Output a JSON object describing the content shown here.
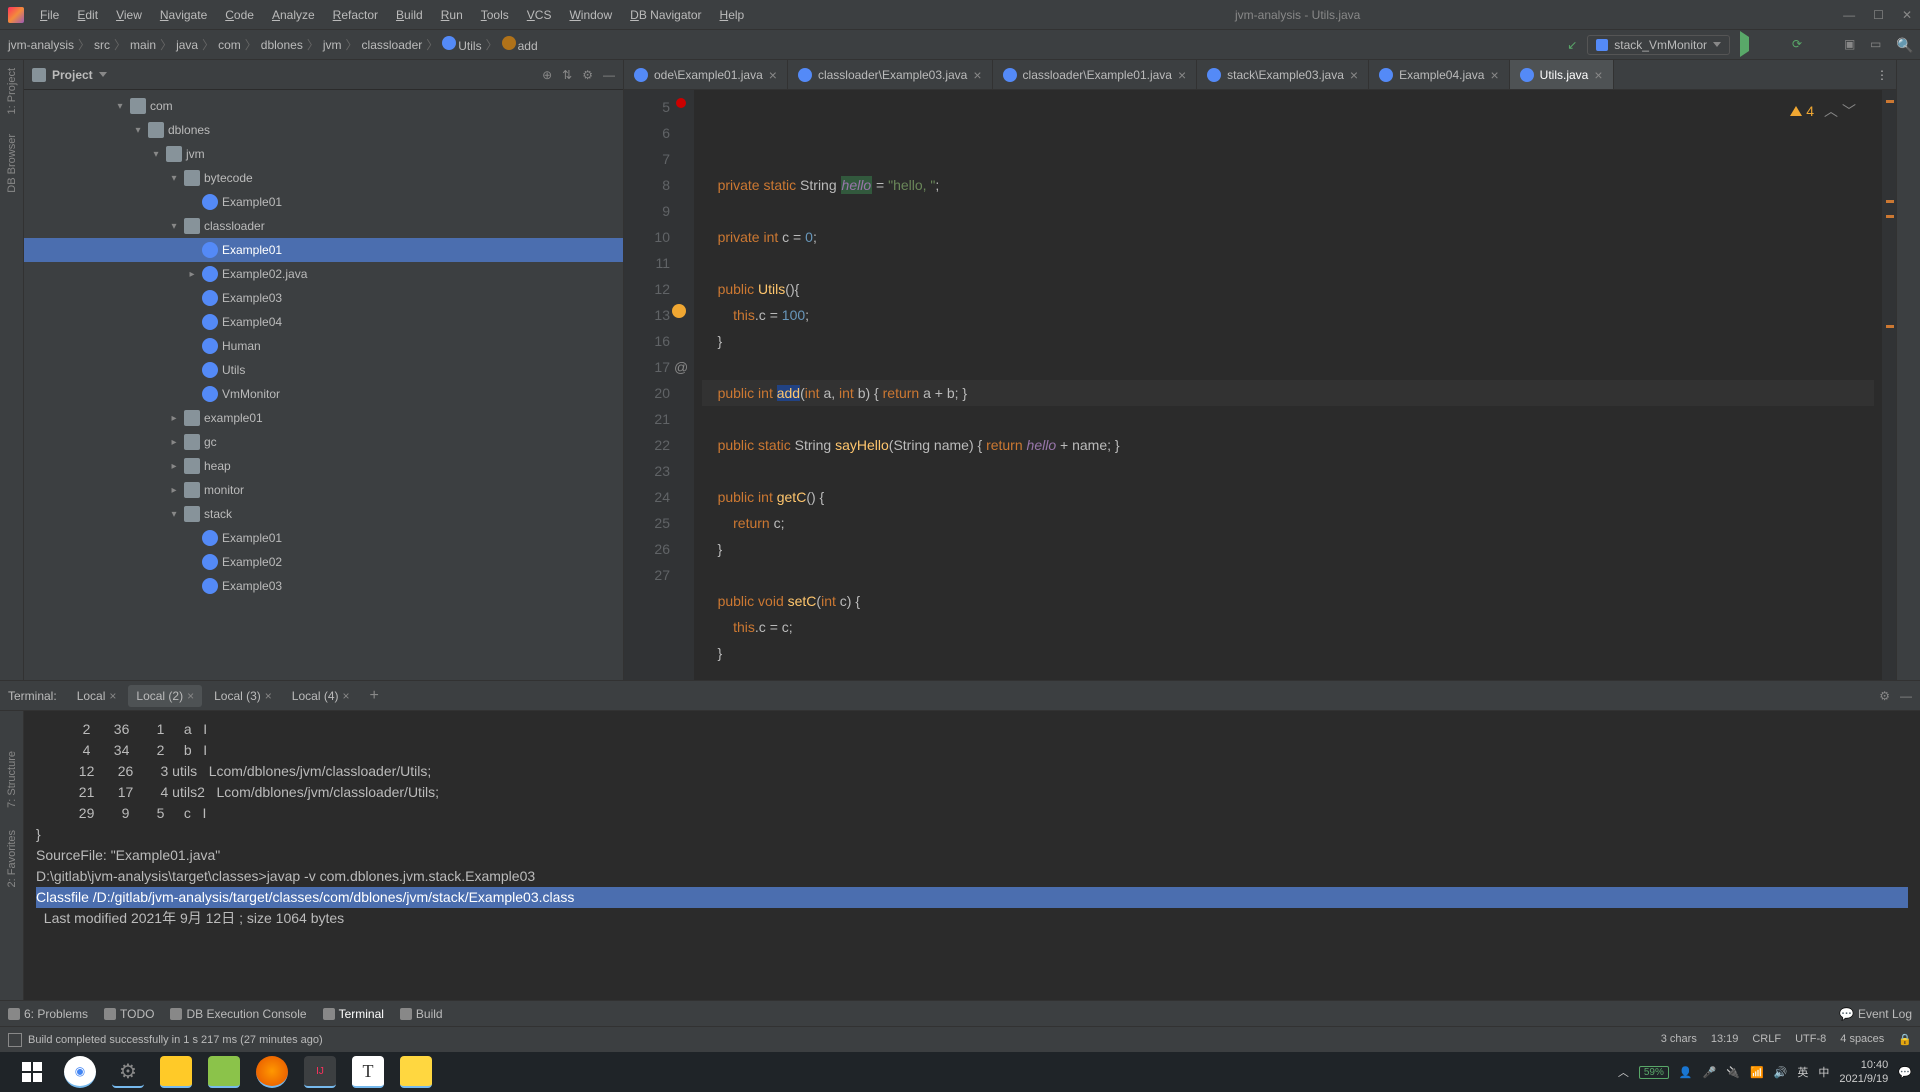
{
  "title": "jvm-analysis - Utils.java",
  "menu": [
    "File",
    "Edit",
    "View",
    "Navigate",
    "Code",
    "Analyze",
    "Refactor",
    "Build",
    "Run",
    "Tools",
    "VCS",
    "Window",
    "DB Navigator",
    "Help"
  ],
  "breadcrumb": [
    "jvm-analysis",
    "src",
    "main",
    "java",
    "com",
    "dblones",
    "jvm",
    "classloader",
    "Utils",
    "add"
  ],
  "runConfig": "stack_VmMonitor",
  "projectPanel": {
    "title": "Project",
    "tree": [
      {
        "indent": 5,
        "arrow": "▾",
        "icon": "pkg",
        "label": "com"
      },
      {
        "indent": 6,
        "arrow": "▾",
        "icon": "pkg",
        "label": "dblones"
      },
      {
        "indent": 7,
        "arrow": "▾",
        "icon": "pkg",
        "label": "jvm"
      },
      {
        "indent": 8,
        "arrow": "▾",
        "icon": "pkg",
        "label": "bytecode"
      },
      {
        "indent": 9,
        "arrow": "",
        "icon": "class",
        "label": "Example01"
      },
      {
        "indent": 8,
        "arrow": "▾",
        "icon": "pkg",
        "label": "classloader"
      },
      {
        "indent": 9,
        "arrow": "",
        "icon": "class",
        "label": "Example01",
        "selected": true
      },
      {
        "indent": 9,
        "arrow": "▸",
        "icon": "java",
        "label": "Example02.java"
      },
      {
        "indent": 9,
        "arrow": "",
        "icon": "class",
        "label": "Example03"
      },
      {
        "indent": 9,
        "arrow": "",
        "icon": "class",
        "label": "Example04"
      },
      {
        "indent": 9,
        "arrow": "",
        "icon": "class",
        "label": "Human"
      },
      {
        "indent": 9,
        "arrow": "",
        "icon": "class",
        "label": "Utils"
      },
      {
        "indent": 9,
        "arrow": "",
        "icon": "class",
        "label": "VmMonitor"
      },
      {
        "indent": 8,
        "arrow": "▸",
        "icon": "pkg",
        "label": "example01"
      },
      {
        "indent": 8,
        "arrow": "▸",
        "icon": "pkg",
        "label": "gc"
      },
      {
        "indent": 8,
        "arrow": "▸",
        "icon": "pkg",
        "label": "heap"
      },
      {
        "indent": 8,
        "arrow": "▸",
        "icon": "pkg",
        "label": "monitor"
      },
      {
        "indent": 8,
        "arrow": "▾",
        "icon": "pkg",
        "label": "stack"
      },
      {
        "indent": 9,
        "arrow": "",
        "icon": "class",
        "label": "Example01"
      },
      {
        "indent": 9,
        "arrow": "",
        "icon": "class",
        "label": "Example02"
      },
      {
        "indent": 9,
        "arrow": "",
        "icon": "class",
        "label": "Example03"
      }
    ]
  },
  "editorTabs": [
    {
      "label": "ode\\Example01.java",
      "active": false
    },
    {
      "label": "classloader\\Example03.java",
      "active": false
    },
    {
      "label": "classloader\\Example01.java",
      "active": false
    },
    {
      "label": "stack\\Example03.java",
      "active": false
    },
    {
      "label": "Example04.java",
      "active": false
    },
    {
      "label": "Utils.java",
      "active": true
    }
  ],
  "warningCount": "4",
  "code": {
    "startLine": 5,
    "lines": [
      {
        "n": 5,
        "err": true,
        "html": "    <span class='kw'>private</span> <span class='kw'>static</span> String <span class='hi2 field-ref'>hello</span> = <span class='str'>\"hello, \"</span>;"
      },
      {
        "n": 6,
        "html": ""
      },
      {
        "n": 7,
        "html": "    <span class='kw'>private</span> <span class='kw'>int</span> c = <span class='num'>0</span>;"
      },
      {
        "n": 8,
        "html": ""
      },
      {
        "n": 9,
        "html": "    <span class='kw'>public</span> <span class='fn'>Utils</span>(){"
      },
      {
        "n": 10,
        "html": "        <span class='kw'>this</span>.c = <span class='num'>100</span>;"
      },
      {
        "n": 11,
        "html": "    }"
      },
      {
        "n": 12,
        "html": ""
      },
      {
        "n": 13,
        "bulb": true,
        "current": true,
        "html": "    <span class='kw'>public</span> <span class='kw'>int</span> <span class='hi fn'>add</span>(<span class='kw'>int</span> a, <span class='kw'>int</span> b) { <span class='kw'>return</span> a + b; }"
      },
      {
        "n": 16,
        "html": ""
      },
      {
        "n": 17,
        "at": true,
        "html": "    <span class='kw'>public</span> <span class='kw'>static</span> String <span class='fn'>sayHello</span>(String name) { <span class='kw'>return</span> <span class='field-ref'>hello</span> + name; }"
      },
      {
        "n": 20,
        "html": ""
      },
      {
        "n": 21,
        "html": "    <span class='kw'>public</span> <span class='kw'>int</span> <span class='fn'>getC</span>() {"
      },
      {
        "n": 22,
        "html": "        <span class='kw'>return</span> c;"
      },
      {
        "n": 23,
        "html": "    }"
      },
      {
        "n": 24,
        "html": ""
      },
      {
        "n": 25,
        "html": "    <span class='kw'>public</span> <span class='kw'>void</span> <span class='fn'>setC</span>(<span class='kw'>int</span> c) {"
      },
      {
        "n": 26,
        "html": "        <span class='kw'>this</span>.c = c;"
      },
      {
        "n": 27,
        "html": "    }"
      }
    ]
  },
  "terminal": {
    "label": "Terminal:",
    "tabs": [
      {
        "label": "Local",
        "active": false
      },
      {
        "label": "Local (2)",
        "active": true
      },
      {
        "label": "Local (3)",
        "active": false
      },
      {
        "label": "Local (4)",
        "active": false
      }
    ],
    "lines": [
      {
        "text": "            2      36       1     a   I"
      },
      {
        "text": "            4      34       2     b   I"
      },
      {
        "text": "           12      26       3 utils   Lcom/dblones/jvm/classloader/Utils;"
      },
      {
        "text": "           21      17       4 utils2   Lcom/dblones/jvm/classloader/Utils;"
      },
      {
        "text": "           29       9       5     c   I"
      },
      {
        "text": "}"
      },
      {
        "text": "SourceFile: \"Example01.java\""
      },
      {
        "text": ""
      },
      {
        "text": "D:\\gitlab\\jvm-analysis\\target\\classes>javap -v com.dblones.jvm.stack.Example03"
      },
      {
        "text": "Classfile /D:/gitlab/jvm-analysis/target/classes/com/dblones/jvm/stack/Example03.class",
        "highlight": true
      },
      {
        "text": "  Last modified 2021年 9月 12日 ; size 1064 bytes"
      }
    ]
  },
  "bottomTools": [
    "6: Problems",
    "TODO",
    "DB Execution Console",
    "Terminal",
    "Build"
  ],
  "bottomToolsActive": "Terminal",
  "eventLog": "Event Log",
  "status": {
    "message": "Build completed successfully in 1 s 217 ms (27 minutes ago)",
    "chars": "3 chars",
    "pos": "13:19",
    "eol": "CRLF",
    "encoding": "UTF-8",
    "indent": "4 spaces"
  },
  "tray": {
    "battery": "59%",
    "ime": "英",
    "ime2": "中",
    "time": "10:40",
    "date": "2021/9/19"
  }
}
